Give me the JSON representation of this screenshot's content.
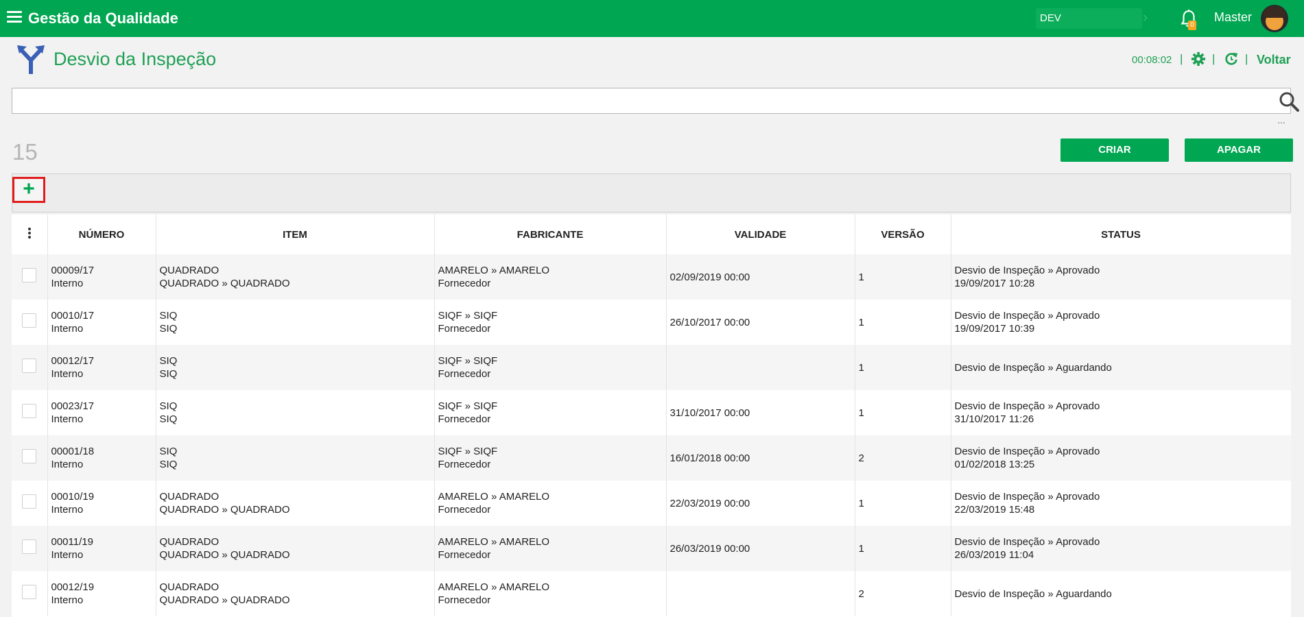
{
  "app": {
    "title": "Gestão da Qualidade",
    "environment": "DEV",
    "notification_count": "0",
    "user_name": "Master"
  },
  "page": {
    "title": "Desvio da Inspeção",
    "timer": "00:08:02",
    "back_label": "Voltar",
    "record_count": "15"
  },
  "search": {
    "placeholder": "",
    "value": ""
  },
  "actions": {
    "create_label": "CRIAR",
    "delete_label": "APAGAR",
    "more_label": "···",
    "add_label": "+"
  },
  "table": {
    "columns": [
      "NÚMERO",
      "ITEM",
      "FABRICANTE",
      "VALIDADE",
      "VERSÃO",
      "STATUS"
    ],
    "rows": [
      {
        "numero": "00009/17",
        "tipo": "Interno",
        "item1": "QUADRADO",
        "item2": "QUADRADO » QUADRADO",
        "fab1": "AMARELO » AMARELO",
        "fab2": "Fornecedor",
        "validade": "02/09/2019 00:00",
        "versao": "1",
        "status1": "Desvio de Inspeção » Aprovado",
        "status2": "19/09/2017 10:28"
      },
      {
        "numero": "00010/17",
        "tipo": "Interno",
        "item1": "SIQ",
        "item2": "SIQ",
        "fab1": "SIQF » SIQF",
        "fab2": "Fornecedor",
        "validade": "26/10/2017 00:00",
        "versao": "1",
        "status1": "Desvio de Inspeção » Aprovado",
        "status2": "19/09/2017 10:39"
      },
      {
        "numero": "00012/17",
        "tipo": "Interno",
        "item1": "SIQ",
        "item2": "SIQ",
        "fab1": "SIQF » SIQF",
        "fab2": "Fornecedor",
        "validade": "",
        "versao": "1",
        "status1": "Desvio de Inspeção » Aguardando",
        "status2": ""
      },
      {
        "numero": "00023/17",
        "tipo": "Interno",
        "item1": "SIQ",
        "item2": "SIQ",
        "fab1": "SIQF » SIQF",
        "fab2": "Fornecedor",
        "validade": "31/10/2017 00:00",
        "versao": "1",
        "status1": "Desvio de Inspeção » Aprovado",
        "status2": "31/10/2017 11:26"
      },
      {
        "numero": "00001/18",
        "tipo": "Interno",
        "item1": "SIQ",
        "item2": "SIQ",
        "fab1": "SIQF » SIQF",
        "fab2": "Fornecedor",
        "validade": "16/01/2018 00:00",
        "versao": "2",
        "status1": "Desvio de Inspeção » Aprovado",
        "status2": "01/02/2018 13:25"
      },
      {
        "numero": "00010/19",
        "tipo": "Interno",
        "item1": "QUADRADO",
        "item2": "QUADRADO » QUADRADO",
        "fab1": "AMARELO » AMARELO",
        "fab2": "Fornecedor",
        "validade": "22/03/2019 00:00",
        "versao": "1",
        "status1": "Desvio de Inspeção » Aprovado",
        "status2": "22/03/2019 15:48"
      },
      {
        "numero": "00011/19",
        "tipo": "Interno",
        "item1": "QUADRADO",
        "item2": "QUADRADO » QUADRADO",
        "fab1": "AMARELO » AMARELO",
        "fab2": "Fornecedor",
        "validade": "26/03/2019 00:00",
        "versao": "1",
        "status1": "Desvio de Inspeção » Aprovado",
        "status2": "26/03/2019 11:04"
      },
      {
        "numero": "00012/19",
        "tipo": "Interno",
        "item1": "QUADRADO",
        "item2": "QUADRADO » QUADRADO",
        "fab1": "AMARELO » AMARELO",
        "fab2": "Fornecedor",
        "validade": "",
        "versao": "2",
        "status1": "Desvio de Inspeção » Aguardando",
        "status2": ""
      }
    ]
  },
  "colors": {
    "brand": "#00a651",
    "title_green": "#1fa055",
    "highlight": "#e01b1b"
  },
  "icons": [
    "menu-icon",
    "chevron-right-icon",
    "bell-icon",
    "fork-icon",
    "gear-icon",
    "refresh-icon",
    "search-icon",
    "more-icon",
    "plus-icon",
    "kebab-icon"
  ]
}
